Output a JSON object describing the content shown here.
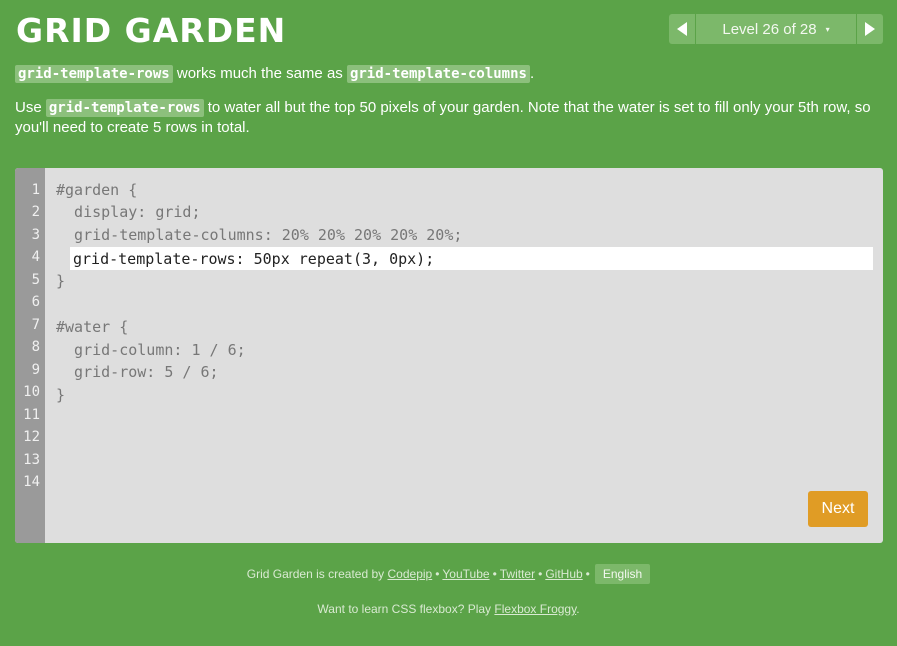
{
  "header": {
    "title": "GRID GARDEN",
    "level_label": "Level 26 of 28",
    "caret": "▾"
  },
  "instructions": {
    "p1": {
      "code_a": "grid-template-rows",
      "text_a": " works much the same as ",
      "code_b": "grid-template-columns",
      "text_b": "."
    },
    "p2": {
      "text_a": "Use ",
      "code_a": "grid-template-rows",
      "text_b": " to water all but the top 50 pixels of your garden. Note that the water is set to fill only your 5th row, so you'll need to create 5 rows in total."
    }
  },
  "editor": {
    "line_numbers": [
      "1",
      "2",
      "3",
      "4",
      "5",
      "6",
      "7",
      "8",
      "9",
      "10",
      "11",
      "12",
      "13",
      "14"
    ],
    "lines": [
      "#garden {",
      "  display: grid;",
      "  grid-template-columns: 20% 20% 20% 20% 20%;",
      "",
      "}",
      "",
      "#water {",
      "  grid-column: 1 / 6;",
      "  grid-row: 5 / 6;",
      "}"
    ],
    "input_value": "grid-template-rows: 50px repeat(3, 0px);",
    "next_label": "Next"
  },
  "footer": {
    "credit_prefix": "Grid Garden is created by",
    "links": [
      "Codepip",
      "YouTube",
      "Twitter",
      "GitHub"
    ],
    "separator": "•",
    "language": "English",
    "promo_text": "Want to learn CSS flexbox? Play",
    "promo_link": "Flexbox Froggy",
    "promo_end": "."
  },
  "colors": {
    "background": "#5ba348",
    "editor": "#dedede",
    "gutter": "#9a9a9a",
    "next_button": "#e09c25"
  }
}
